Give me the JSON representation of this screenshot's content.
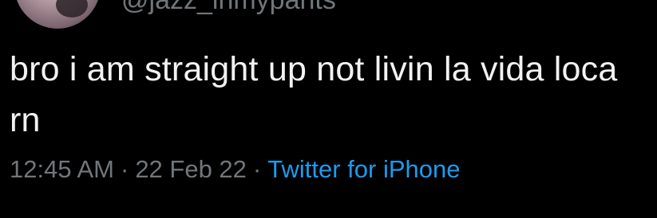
{
  "tweet": {
    "handle": "@jazz_inmypants",
    "text": "bro i am straight up not livin la vida loca rn",
    "time": "12:45 AM",
    "separator": "·",
    "date": "22 Feb 22",
    "source": "Twitter for iPhone"
  },
  "colors": {
    "background": "#000000",
    "text": "#f2f2f2",
    "muted": "#71767b",
    "link": "#1d9bf0"
  }
}
